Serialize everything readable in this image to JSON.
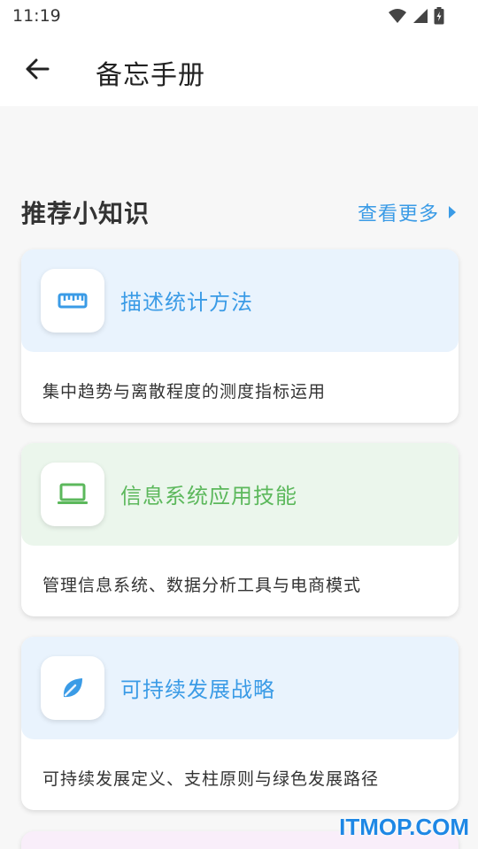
{
  "status_bar": {
    "time": "11:19"
  },
  "app_bar": {
    "title": "备忘手册"
  },
  "section": {
    "title": "推荐小知识",
    "more_label": "查看更多"
  },
  "cards": [
    {
      "title": "描述统计方法",
      "description": "集中趋势与离散程度的测度指标运用",
      "icon": "ruler-icon",
      "accent": "#3a9be6",
      "header_bg": "#e9f3fd"
    },
    {
      "title": "信息系统应用技能",
      "description": "管理信息系统、数据分析工具与电商模式",
      "icon": "laptop-icon",
      "accent": "#5cb85c",
      "header_bg": "#ebf6ec"
    },
    {
      "title": "可持续发展战略",
      "description": "可持续发展定义、支柱原则与绿色发展路径",
      "icon": "leaf-icon",
      "accent": "#3a9be6",
      "header_bg": "#e9f3fd"
    }
  ],
  "watermark": "ITMOP.COM",
  "colors": {
    "accent_blue": "#3a9be6",
    "accent_green": "#5cb85c",
    "background": "#f7f7f7"
  }
}
